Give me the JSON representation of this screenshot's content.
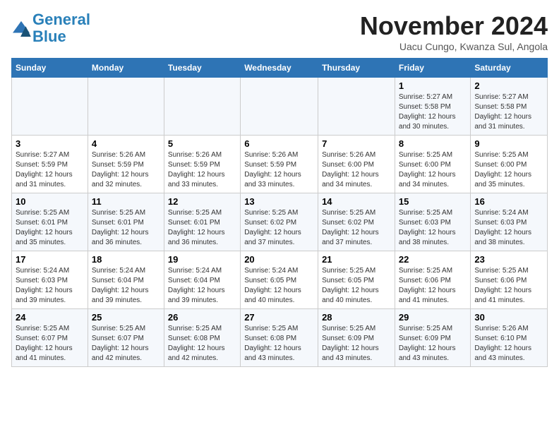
{
  "logo": {
    "line1": "General",
    "line2": "Blue"
  },
  "title": "November 2024",
  "subtitle": "Uacu Cungo, Kwanza Sul, Angola",
  "weekdays": [
    "Sunday",
    "Monday",
    "Tuesday",
    "Wednesday",
    "Thursday",
    "Friday",
    "Saturday"
  ],
  "weeks": [
    [
      {
        "day": "",
        "info": ""
      },
      {
        "day": "",
        "info": ""
      },
      {
        "day": "",
        "info": ""
      },
      {
        "day": "",
        "info": ""
      },
      {
        "day": "",
        "info": ""
      },
      {
        "day": "1",
        "info": "Sunrise: 5:27 AM\nSunset: 5:58 PM\nDaylight: 12 hours and 30 minutes."
      },
      {
        "day": "2",
        "info": "Sunrise: 5:27 AM\nSunset: 5:58 PM\nDaylight: 12 hours and 31 minutes."
      }
    ],
    [
      {
        "day": "3",
        "info": "Sunrise: 5:27 AM\nSunset: 5:59 PM\nDaylight: 12 hours and 31 minutes."
      },
      {
        "day": "4",
        "info": "Sunrise: 5:26 AM\nSunset: 5:59 PM\nDaylight: 12 hours and 32 minutes."
      },
      {
        "day": "5",
        "info": "Sunrise: 5:26 AM\nSunset: 5:59 PM\nDaylight: 12 hours and 33 minutes."
      },
      {
        "day": "6",
        "info": "Sunrise: 5:26 AM\nSunset: 5:59 PM\nDaylight: 12 hours and 33 minutes."
      },
      {
        "day": "7",
        "info": "Sunrise: 5:26 AM\nSunset: 6:00 PM\nDaylight: 12 hours and 34 minutes."
      },
      {
        "day": "8",
        "info": "Sunrise: 5:25 AM\nSunset: 6:00 PM\nDaylight: 12 hours and 34 minutes."
      },
      {
        "day": "9",
        "info": "Sunrise: 5:25 AM\nSunset: 6:00 PM\nDaylight: 12 hours and 35 minutes."
      }
    ],
    [
      {
        "day": "10",
        "info": "Sunrise: 5:25 AM\nSunset: 6:01 PM\nDaylight: 12 hours and 35 minutes."
      },
      {
        "day": "11",
        "info": "Sunrise: 5:25 AM\nSunset: 6:01 PM\nDaylight: 12 hours and 36 minutes."
      },
      {
        "day": "12",
        "info": "Sunrise: 5:25 AM\nSunset: 6:01 PM\nDaylight: 12 hours and 36 minutes."
      },
      {
        "day": "13",
        "info": "Sunrise: 5:25 AM\nSunset: 6:02 PM\nDaylight: 12 hours and 37 minutes."
      },
      {
        "day": "14",
        "info": "Sunrise: 5:25 AM\nSunset: 6:02 PM\nDaylight: 12 hours and 37 minutes."
      },
      {
        "day": "15",
        "info": "Sunrise: 5:25 AM\nSunset: 6:03 PM\nDaylight: 12 hours and 38 minutes."
      },
      {
        "day": "16",
        "info": "Sunrise: 5:24 AM\nSunset: 6:03 PM\nDaylight: 12 hours and 38 minutes."
      }
    ],
    [
      {
        "day": "17",
        "info": "Sunrise: 5:24 AM\nSunset: 6:03 PM\nDaylight: 12 hours and 39 minutes."
      },
      {
        "day": "18",
        "info": "Sunrise: 5:24 AM\nSunset: 6:04 PM\nDaylight: 12 hours and 39 minutes."
      },
      {
        "day": "19",
        "info": "Sunrise: 5:24 AM\nSunset: 6:04 PM\nDaylight: 12 hours and 39 minutes."
      },
      {
        "day": "20",
        "info": "Sunrise: 5:24 AM\nSunset: 6:05 PM\nDaylight: 12 hours and 40 minutes."
      },
      {
        "day": "21",
        "info": "Sunrise: 5:25 AM\nSunset: 6:05 PM\nDaylight: 12 hours and 40 minutes."
      },
      {
        "day": "22",
        "info": "Sunrise: 5:25 AM\nSunset: 6:06 PM\nDaylight: 12 hours and 41 minutes."
      },
      {
        "day": "23",
        "info": "Sunrise: 5:25 AM\nSunset: 6:06 PM\nDaylight: 12 hours and 41 minutes."
      }
    ],
    [
      {
        "day": "24",
        "info": "Sunrise: 5:25 AM\nSunset: 6:07 PM\nDaylight: 12 hours and 41 minutes."
      },
      {
        "day": "25",
        "info": "Sunrise: 5:25 AM\nSunset: 6:07 PM\nDaylight: 12 hours and 42 minutes."
      },
      {
        "day": "26",
        "info": "Sunrise: 5:25 AM\nSunset: 6:08 PM\nDaylight: 12 hours and 42 minutes."
      },
      {
        "day": "27",
        "info": "Sunrise: 5:25 AM\nSunset: 6:08 PM\nDaylight: 12 hours and 43 minutes."
      },
      {
        "day": "28",
        "info": "Sunrise: 5:25 AM\nSunset: 6:09 PM\nDaylight: 12 hours and 43 minutes."
      },
      {
        "day": "29",
        "info": "Sunrise: 5:25 AM\nSunset: 6:09 PM\nDaylight: 12 hours and 43 minutes."
      },
      {
        "day": "30",
        "info": "Sunrise: 5:26 AM\nSunset: 6:10 PM\nDaylight: 12 hours and 43 minutes."
      }
    ]
  ]
}
